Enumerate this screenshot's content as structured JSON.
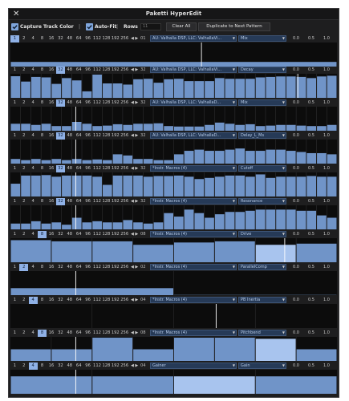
{
  "window": {
    "title": "Paketti HyperEdit"
  },
  "icons": {
    "close": "close-icon",
    "check": "check-icon",
    "chevron": "chevron-down-icon"
  },
  "colors": {
    "bar": "#7094c8",
    "bar_highlight": "#a8c4ee",
    "accent": "#8fb1e6",
    "background": "#0c0c0c",
    "dropdown": "#263a57"
  },
  "toolbar": {
    "capture_label": "Capture Track Color",
    "capture_checked": true,
    "separator1": "|",
    "autofit_label": "Auto-Fit",
    "autofit_checked": true,
    "separator2": "|",
    "rows_label": "Rows",
    "rows_value": "11",
    "clear_all": "Clear All",
    "duplicate": "Duplicate to Next Pattern"
  },
  "value_buttons": [
    "0.0",
    "0.5",
    "1.0"
  ],
  "steps": [
    "1",
    "2",
    "4",
    "8",
    "16",
    "32",
    "48",
    "64",
    "96",
    "112",
    "128",
    "192",
    "256"
  ],
  "rows": [
    {
      "selected_step": "1",
      "nav": "◀ ▶",
      "number": "01",
      "device": "AU: Valhalla DSP, LLC: ValhallaVi...",
      "parameter": "Mix",
      "cursor": 0.585,
      "values": [
        0.2
      ]
    },
    {
      "selected_step": "32",
      "nav": "◀ ▶",
      "number": "32",
      "device": "AU: Valhalla DSP, LLC: ValhallaVi...",
      "parameter": "Decay",
      "cursor": 0.88,
      "values": [
        0.93,
        0.7,
        0.9,
        0.88,
        0.6,
        0.85,
        0.75,
        0.28,
        1.0,
        0.62,
        0.62,
        0.57,
        0.8,
        0.82,
        0.65,
        0.8,
        0.82,
        0.72,
        0.72,
        0.72,
        0.85,
        0.82,
        0.82,
        0.82,
        0.88,
        0.9,
        0.92,
        0.92,
        0.9,
        0.85,
        0.92,
        0.95
      ]
    },
    {
      "selected_step": "32",
      "nav": "◀ ▶",
      "number": "32",
      "device": "AU: Valhalla DSP, LLC: ValhallaD...",
      "parameter": "Mix",
      "cursor": 0.2,
      "values": [
        0.3,
        0.3,
        0.25,
        0.3,
        0.2,
        0.2,
        0.38,
        0.3,
        0.2,
        0.22,
        0.28,
        0.25,
        0.3,
        0.3,
        0.32,
        0.2,
        0.18,
        0.18,
        0.18,
        0.25,
        0.35,
        0.3,
        0.25,
        0.28,
        0.2,
        0.22,
        0.25,
        0.25,
        0.22,
        0.2,
        0.2,
        0.25
      ]
    },
    {
      "selected_step": "32",
      "nav": "◀ ▶",
      "number": "32",
      "device": "AU: Valhalla DSP, LLC: ValhallaD...",
      "parameter": "Delay_L_Ms",
      "cursor": 0.2,
      "values": [
        0.2,
        0.15,
        0.2,
        0.15,
        0.2,
        0.15,
        0.2,
        0.15,
        0.18,
        0.15,
        0.4,
        0.35,
        0.2,
        0.2,
        0.15,
        0.15,
        0.4,
        0.55,
        0.6,
        0.55,
        0.55,
        0.6,
        0.65,
        0.55,
        0.55,
        0.6,
        0.6,
        0.55,
        0.5,
        0.45,
        0.45,
        0.4
      ]
    },
    {
      "selected_step": "32",
      "nav": "◀ ▶",
      "number": "32",
      "device": "*Instr. Macros (4)",
      "parameter": "Cutoff",
      "cursor": 0.2,
      "values": [
        0.55,
        0.9,
        0.9,
        0.92,
        0.85,
        0.9,
        0.9,
        0.9,
        0.85,
        0.5,
        0.9,
        0.9,
        0.9,
        0.85,
        0.88,
        0.88,
        0.9,
        0.85,
        0.75,
        0.8,
        0.85,
        0.9,
        0.9,
        0.85,
        0.95,
        0.8,
        0.85,
        0.85,
        0.85,
        0.88,
        0.85,
        0.85
      ]
    },
    {
      "selected_step": "32",
      "nav": "◀ ▶",
      "number": "32",
      "device": "*Instr. Macros (4)",
      "parameter": "Resonance",
      "cursor": 0.2,
      "values": [
        0.25,
        0.25,
        0.35,
        0.25,
        0.3,
        0.2,
        0.5,
        0.3,
        0.35,
        0.3,
        0.3,
        0.4,
        0.3,
        0.25,
        0.3,
        0.7,
        0.55,
        0.85,
        0.7,
        0.5,
        0.65,
        0.75,
        0.75,
        0.8,
        0.85,
        0.85,
        0.85,
        0.85,
        0.8,
        0.8,
        0.6,
        0.5
      ]
    },
    {
      "selected_step": "8",
      "nav": "◀ ▶",
      "number": "08",
      "device": "*Instr. Macros (4)",
      "parameter": "Drive",
      "cursor": 0.84,
      "highlight": [
        6
      ],
      "values": [
        0.95,
        0.9,
        0.9,
        0.75,
        0.85,
        0.9,
        0.75,
        0.8
      ]
    },
    {
      "selected_step": "2",
      "nav": "◀ ▶",
      "number": "02",
      "device": "*Instr. Macros (4)",
      "parameter": "ParallelComp",
      "cursor": 0.2,
      "values": [
        0.3,
        0.01
      ]
    },
    {
      "selected_step": "4",
      "nav": "◀ ▶",
      "number": "04",
      "device": "*Instr. Macros (4)",
      "parameter": "PB Inertia",
      "cursor": 0.63,
      "values": [
        0.0,
        0.0,
        0.0,
        0.0
      ]
    },
    {
      "selected_step": "8",
      "nav": "◀ ▶",
      "number": "08",
      "device": "*Instr. Macros (4)",
      "parameter": "Pitchbend",
      "cursor": 0.2,
      "highlight": [
        6
      ],
      "values": [
        0.5,
        0.5,
        1.0,
        0.5,
        1.0,
        1.0,
        0.95,
        0.5
      ]
    },
    {
      "selected_step": "4",
      "nav": "◀ ▶",
      "number": "04",
      "device": "Gainer",
      "parameter": "Gain",
      "cursor": 0.2,
      "highlight": [
        2
      ],
      "values": [
        0.75,
        0.75,
        0.75,
        0.75
      ]
    }
  ]
}
